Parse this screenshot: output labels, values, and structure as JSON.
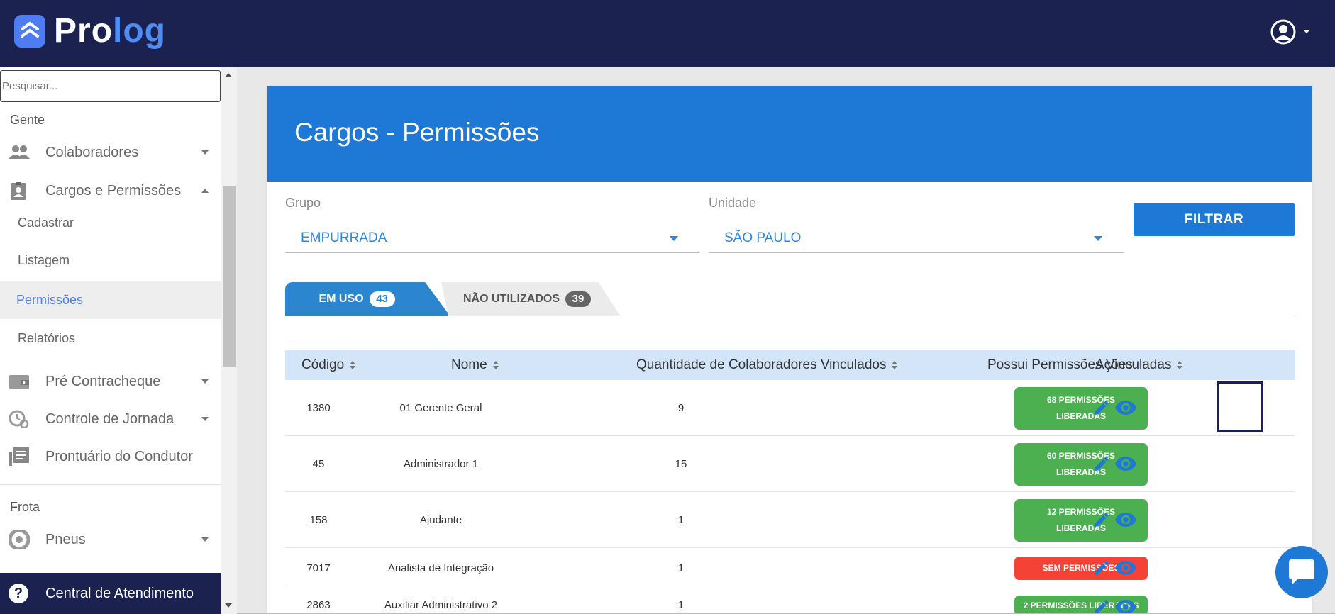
{
  "app": {
    "logo_part1": "Pro",
    "logo_part2": "log"
  },
  "search": {
    "placeholder": "Pesquisar..."
  },
  "sidebar": {
    "section_gente": "Gente",
    "items": [
      {
        "label": "Colaboradores",
        "icon": "people-icon"
      },
      {
        "label": "Cargos e Permissões",
        "icon": "badge-icon"
      },
      {
        "label": "Pré Contracheque",
        "icon": "wallet-icon"
      },
      {
        "label": "Controle de Jornada",
        "icon": "clock-icon"
      },
      {
        "label": "Prontuário do Condutor",
        "icon": "library-icon"
      },
      {
        "label": "Pneus",
        "icon": "tire-icon"
      }
    ],
    "subitems": [
      {
        "label": "Cadastrar"
      },
      {
        "label": "Listagem"
      },
      {
        "label": "Permissões",
        "active": true
      },
      {
        "label": "Relatórios"
      }
    ],
    "section_frota": "Frota",
    "help": "Central de Atendimento"
  },
  "page": {
    "title": "Cargos - Permissões"
  },
  "filters": {
    "grupo_label": "Grupo",
    "grupo_value": "EMPURRADA",
    "unidade_label": "Unidade",
    "unidade_value": "SÃO PAULO",
    "filter_button": "FILTRAR"
  },
  "tabs": [
    {
      "label": "EM USO",
      "count": "43",
      "active": true
    },
    {
      "label": "NÃO UTILIZADOS",
      "count": "39",
      "active": false
    }
  ],
  "table": {
    "columns": [
      "Código",
      "Nome",
      "Quantidade de Colaboradores Vinculados",
      "Possui Permissões Vinculadas",
      "Ações"
    ],
    "rows": [
      {
        "codigo": "1380",
        "nome": "01 Gerente Geral",
        "qtd": "9",
        "perm_line1": "68 PERMISSÕES",
        "perm_line2": "LIBERADAS",
        "perm_color": "#4caf50"
      },
      {
        "codigo": "45",
        "nome": "Administrador 1",
        "qtd": "15",
        "perm_line1": "60 PERMISSÕES",
        "perm_line2": "LIBERADAS",
        "perm_color": "#4caf50"
      },
      {
        "codigo": "158",
        "nome": "Ajudante",
        "qtd": "1",
        "perm_line1": "12 PERMISSÕES",
        "perm_line2": "LIBERADAS",
        "perm_color": "#4caf50"
      },
      {
        "codigo": "7017",
        "nome": "Analista de Integração",
        "qtd": "1",
        "perm_line1": "SEM PERMISSÕES",
        "perm_line2": "",
        "perm_color": "#f44336"
      },
      {
        "codigo": "2863",
        "nome": "Auxiliar Administrativo 2",
        "qtd": "1",
        "perm_line1": "2 PERMISSÕES LIBERADAS",
        "perm_line2": "",
        "perm_color": "#4caf50"
      }
    ]
  },
  "colors": {
    "topbar": "#1b2250",
    "primary": "#1e78d6",
    "accent": "#4e7cf2",
    "green": "#4caf50",
    "red": "#f44336"
  }
}
